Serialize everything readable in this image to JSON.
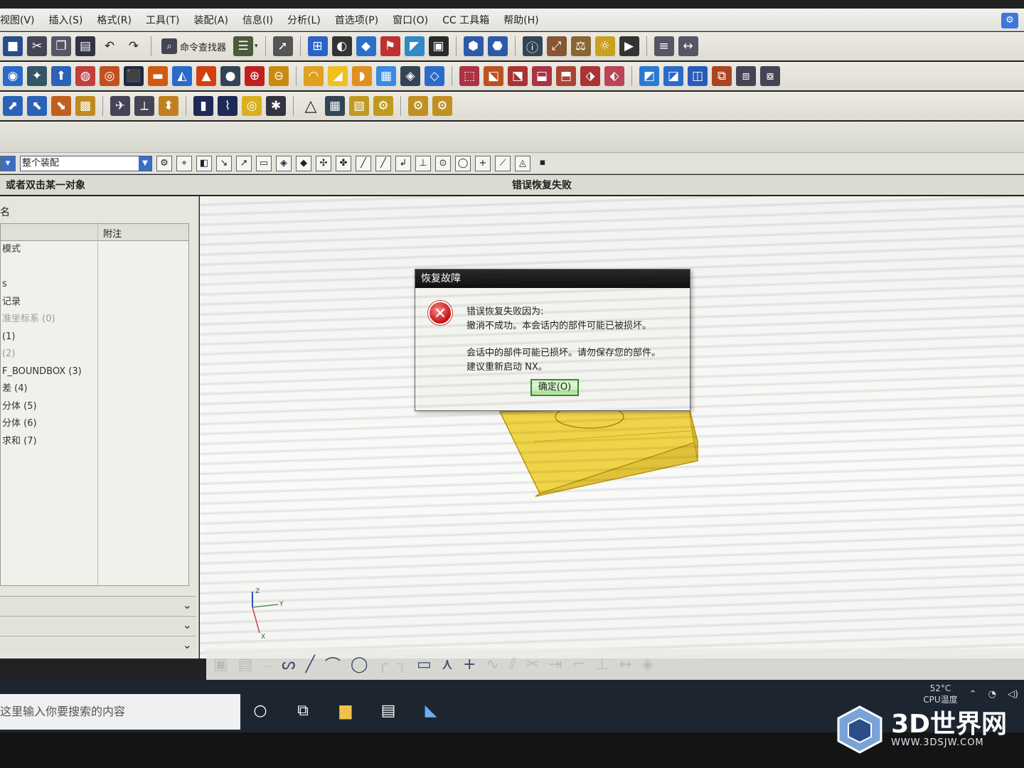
{
  "menubar": {
    "items": [
      "视图(V)",
      "插入(S)",
      "格式(R)",
      "工具(T)",
      "装配(A)",
      "信息(I)",
      "分析(L)",
      "首选项(P)",
      "窗口(O)",
      "CC 工具箱",
      "帮助(H)"
    ]
  },
  "toolbar": {
    "command_finder_label": "命令查找器"
  },
  "selection_bar": {
    "filter_value": "整个装配"
  },
  "status": {
    "left": "或者双击某一对象",
    "center": "错误恢复失败"
  },
  "navigator": {
    "header_annotation": "附注",
    "rows": [
      {
        "text": "模式",
        "dim": false
      },
      {
        "text": "",
        "dim": false
      },
      {
        "text": "s",
        "dim": false
      },
      {
        "text": "记录",
        "dim": false
      },
      {
        "text": "准坐标系 (0)",
        "dim": true
      },
      {
        "text": "(1)",
        "dim": false
      },
      {
        "text": "(2)",
        "dim": true
      },
      {
        "text": "F_BOUNDBOX (3)",
        "dim": false
      },
      {
        "text": "差 (4)",
        "dim": false
      },
      {
        "text": "分体 (5)",
        "dim": false
      },
      {
        "text": "分体 (6)",
        "dim": false
      },
      {
        "text": "求和 (7)",
        "dim": false
      }
    ]
  },
  "dialog": {
    "title": "恢复故障",
    "line1": "错误恢复失败因为:",
    "line2": "撤消不成功。本会话内的部件可能已被损坏。",
    "line3": "会话中的部件可能已损坏。请勿保存您的部件。",
    "line4": "建议重新启动 NX。",
    "ok_label": "确定(O)",
    "icon": "error-x-icon"
  },
  "taskbar": {
    "search_placeholder": "这里输入你要搜索的内容",
    "temperature": "52°C",
    "temperature_label": "CPU温度"
  },
  "watermark": {
    "text": "3D世界网",
    "url": "WWW.3DSJW.COM"
  },
  "colors": {
    "part_yellow": "#f2d64a",
    "dialog_title_bg": "#141414",
    "error_red": "#c81010",
    "ok_green": "#3a8a2a"
  }
}
